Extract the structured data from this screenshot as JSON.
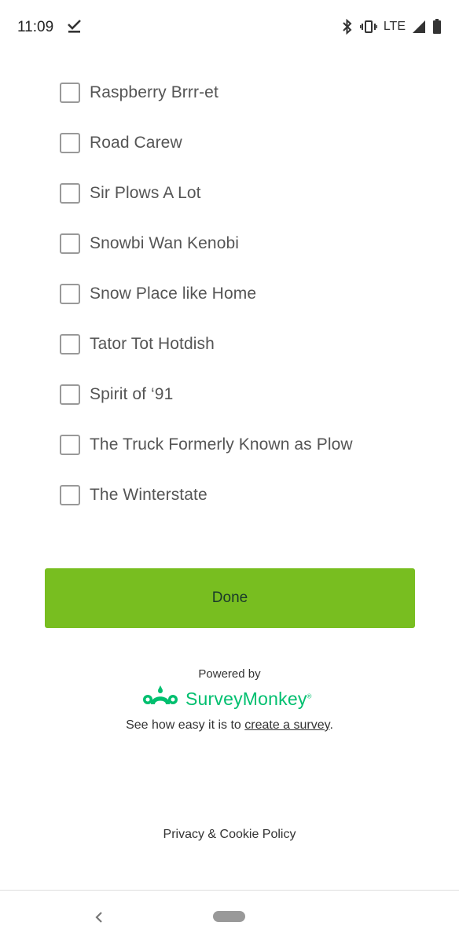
{
  "status_bar": {
    "time": "11:09",
    "network": "LTE",
    "icons": [
      "download-done-icon",
      "bluetooth-icon",
      "vibrate-icon",
      "signal-icon",
      "battery-icon"
    ]
  },
  "options": [
    {
      "label": "Raspberry Brrr-et",
      "checked": false
    },
    {
      "label": "Road Carew",
      "checked": false
    },
    {
      "label": "Sir Plows A Lot",
      "checked": false
    },
    {
      "label": "Snowbi Wan Kenobi",
      "checked": false
    },
    {
      "label": "Snow Place like Home",
      "checked": false
    },
    {
      "label": "Tator Tot Hotdish",
      "checked": false
    },
    {
      "label": "Spirit of ‘91",
      "checked": false
    },
    {
      "label": "The Truck Formerly Known as Plow",
      "checked": false
    },
    {
      "label": "The Winterstate",
      "checked": false
    }
  ],
  "done_button": {
    "label": "Done",
    "color": "#78be20"
  },
  "footer": {
    "powered_by": "Powered by",
    "brand": "SurveyMonkey",
    "brand_color": "#00bf6f",
    "tagline_prefix": "See how easy it is to ",
    "tagline_link": "create a survey",
    "tagline_suffix": ".",
    "privacy": "Privacy & Cookie Policy"
  }
}
